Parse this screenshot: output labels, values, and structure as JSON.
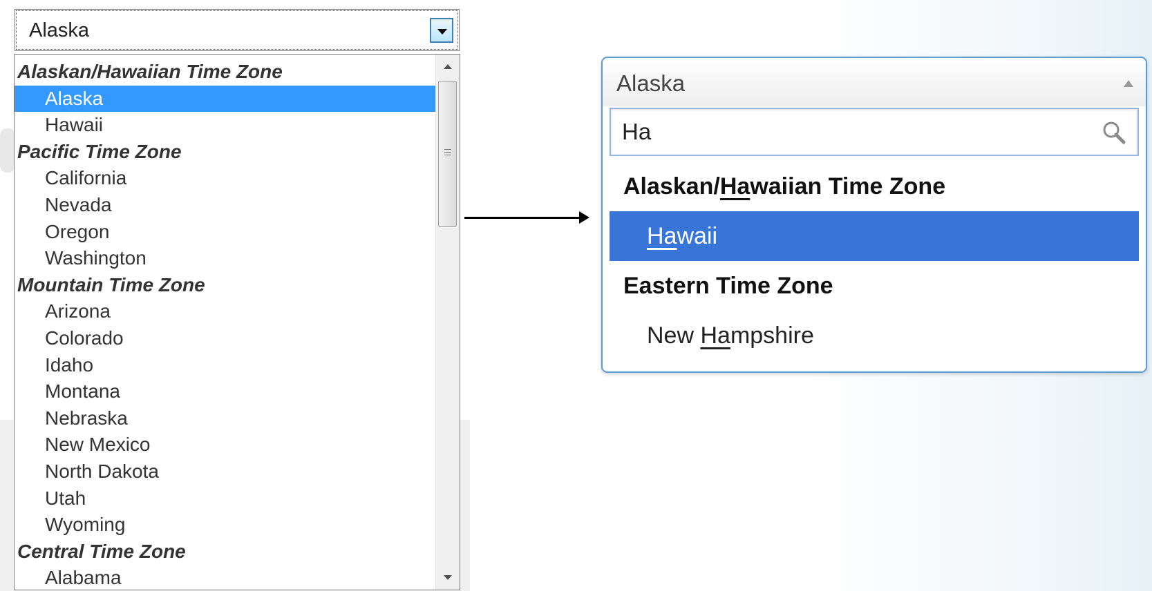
{
  "native_select": {
    "value": "Alaska",
    "items": [
      {
        "type": "group",
        "label": "Alaskan/Hawaiian Time Zone"
      },
      {
        "type": "option",
        "label": "Alaska",
        "selected": true
      },
      {
        "type": "option",
        "label": "Hawaii"
      },
      {
        "type": "group",
        "label": "Pacific Time Zone"
      },
      {
        "type": "option",
        "label": "California"
      },
      {
        "type": "option",
        "label": "Nevada"
      },
      {
        "type": "option",
        "label": "Oregon"
      },
      {
        "type": "option",
        "label": "Washington"
      },
      {
        "type": "group",
        "label": "Mountain Time Zone"
      },
      {
        "type": "option",
        "label": "Arizona"
      },
      {
        "type": "option",
        "label": "Colorado"
      },
      {
        "type": "option",
        "label": "Idaho"
      },
      {
        "type": "option",
        "label": "Montana"
      },
      {
        "type": "option",
        "label": "Nebraska"
      },
      {
        "type": "option",
        "label": "New Mexico"
      },
      {
        "type": "option",
        "label": "North Dakota"
      },
      {
        "type": "option",
        "label": "Utah"
      },
      {
        "type": "option",
        "label": "Wyoming"
      },
      {
        "type": "group",
        "label": "Central Time Zone"
      },
      {
        "type": "option",
        "label": "Alabama"
      }
    ]
  },
  "custom_dropdown": {
    "value": "Alaska",
    "search_query": "Ha",
    "search_icon": "magnifier-icon",
    "results": [
      {
        "type": "group",
        "pre": "Alaskan/",
        "match": "Ha",
        "post": "waiian Time Zone"
      },
      {
        "type": "option",
        "pre": "",
        "match": "Ha",
        "post": "waii",
        "highlighted": true
      },
      {
        "type": "group",
        "pre": "Eastern Time Zone",
        "match": "",
        "post": ""
      },
      {
        "type": "option",
        "pre": "New ",
        "match": "Ha",
        "post": "mpshire"
      }
    ]
  },
  "colors": {
    "native_selected": "#3399ff",
    "custom_highlight": "#3875d7",
    "custom_border": "#5b9bd5"
  }
}
